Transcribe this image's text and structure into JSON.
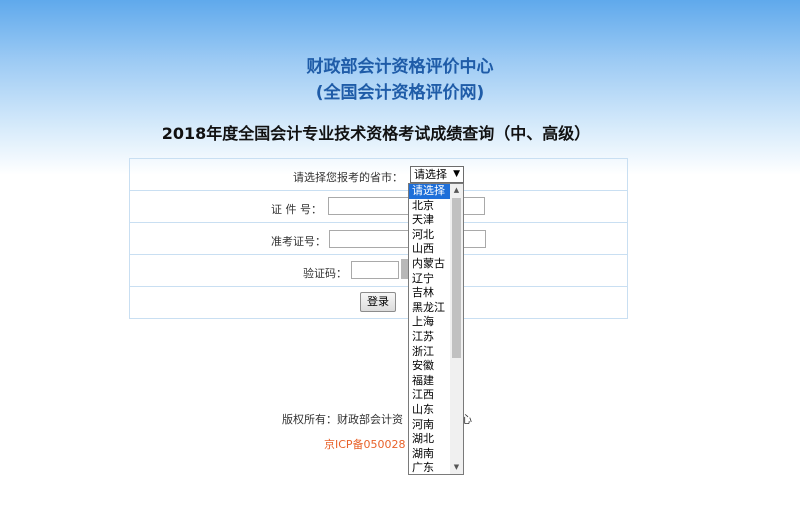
{
  "header": {
    "title_line1": "财政部会计资格评价中心",
    "title_line2": "(全国会计资格评价网)"
  },
  "query_title": "2018年度全国会计专业技术资格考试成绩查询（中、高级）",
  "form": {
    "province_label": "请选择您报考的省市：",
    "province_selected": "请选择",
    "id_label": "证 件 号：",
    "ticket_label": "准考证号：",
    "captcha_label": "验证码：",
    "login_button": "登录"
  },
  "province_options": [
    "请选择",
    "北京",
    "天津",
    "河北",
    "山西",
    "内蒙古",
    "辽宁",
    "吉林",
    "黑龙江",
    "上海",
    "江苏",
    "浙江",
    "安徽",
    "福建",
    "江西",
    "山东",
    "河南",
    "湖北",
    "湖南",
    "广东"
  ],
  "footer": {
    "copyright": "版权所有：财政部会计资",
    "copyright_tail": "心",
    "icp": "京ICP备050028"
  }
}
